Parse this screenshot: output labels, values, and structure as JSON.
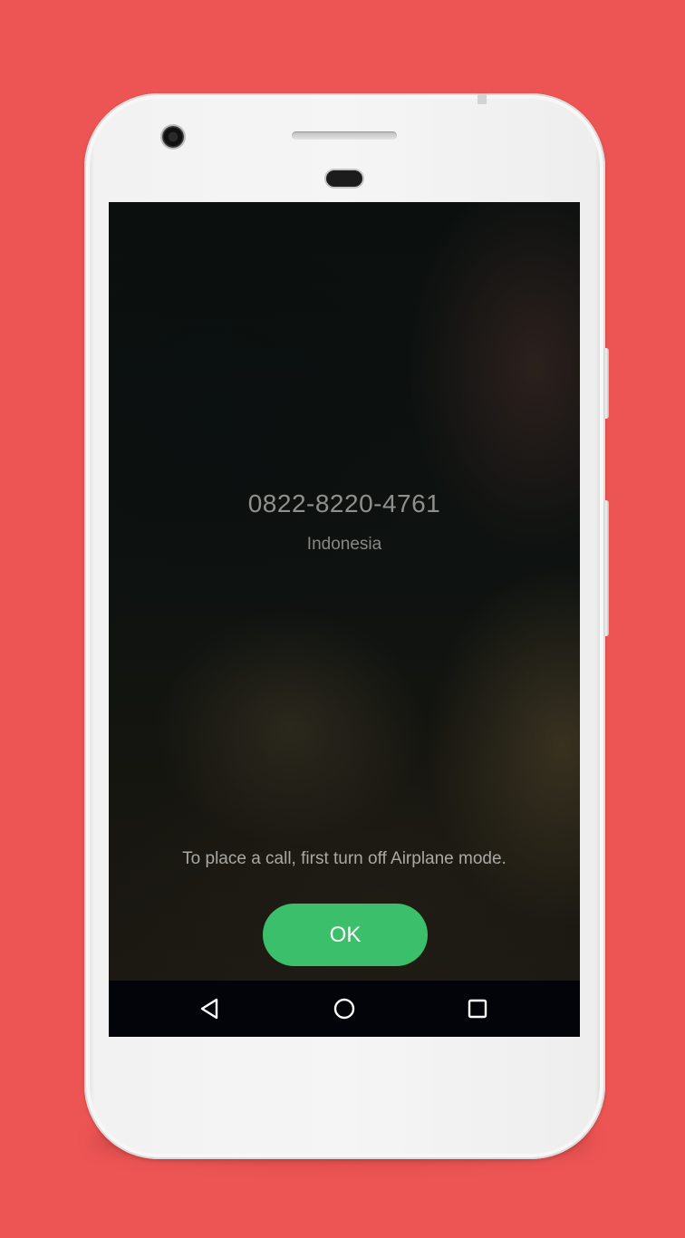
{
  "call_screen": {
    "phone_number": "0822-8220-4761",
    "location": "Indonesia",
    "message": "To place a call, first turn off Airplane mode.",
    "ok_label": "OK"
  },
  "nav_bar": {
    "back_icon": "back-triangle-icon",
    "home_icon": "home-circle-icon",
    "recents_icon": "recents-square-icon"
  },
  "colors": {
    "background": "#ec5554",
    "ok_button": "#3bbf6b",
    "nav_bar": "#03030a"
  }
}
